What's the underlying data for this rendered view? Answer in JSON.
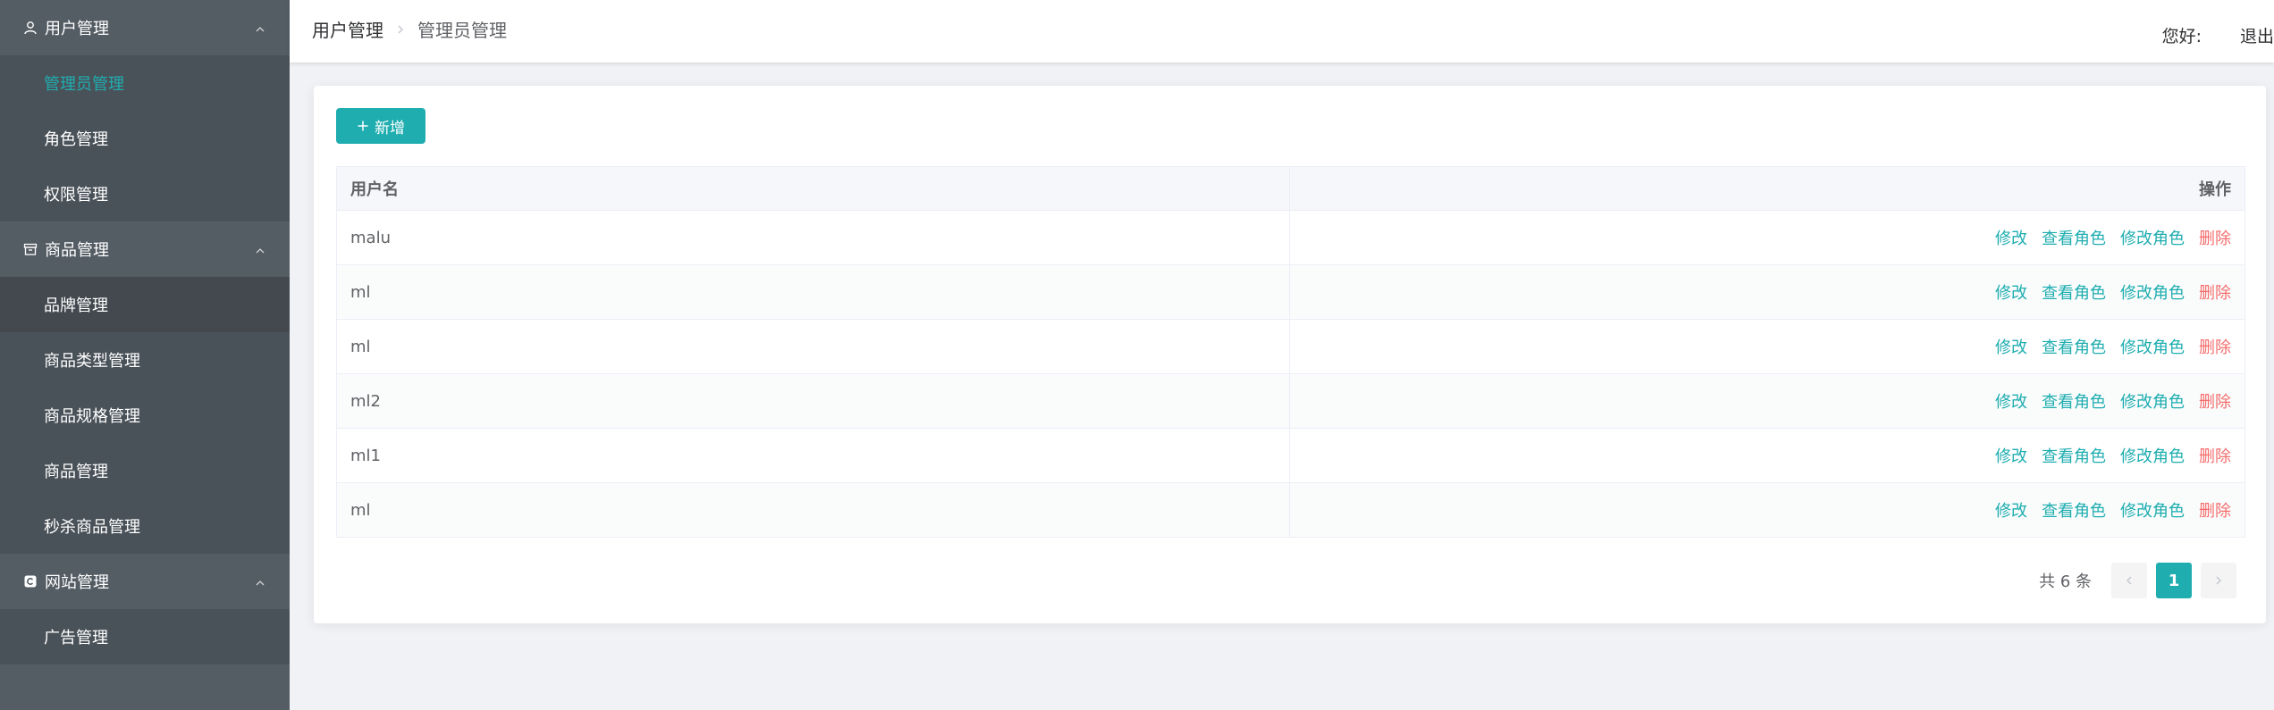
{
  "colors": {
    "accent": "#1fadb0",
    "danger": "#f56c6c",
    "sidebar_bg": "#545c64"
  },
  "sidebar": {
    "groups": [
      {
        "title": "用户管理",
        "icon": "user-icon",
        "items": [
          {
            "label": "管理员管理",
            "active": true
          },
          {
            "label": "角色管理"
          },
          {
            "label": "权限管理"
          }
        ]
      },
      {
        "title": "商品管理",
        "icon": "box-icon",
        "items": [
          {
            "label": "品牌管理"
          },
          {
            "label": "商品类型管理"
          },
          {
            "label": "商品规格管理"
          },
          {
            "label": "商品管理"
          },
          {
            "label": "秒杀商品管理"
          }
        ]
      },
      {
        "title": "网站管理",
        "icon": "site-icon",
        "items": [
          {
            "label": "广告管理"
          }
        ]
      }
    ]
  },
  "header": {
    "breadcrumb": [
      "用户管理",
      "管理员管理"
    ],
    "greeting": "您好:",
    "logout": "退出"
  },
  "toolbar": {
    "add_label": "新增"
  },
  "table": {
    "columns": [
      "用户名",
      "操作"
    ],
    "actions": {
      "edit": "修改",
      "view_roles": "查看角色",
      "edit_roles": "修改角色",
      "delete": "删除"
    },
    "rows": [
      {
        "username": "malu"
      },
      {
        "username": "ml"
      },
      {
        "username": "ml"
      },
      {
        "username": "ml2"
      },
      {
        "username": "ml1"
      },
      {
        "username": "ml"
      }
    ]
  },
  "pagination": {
    "total_text": "共 6 条",
    "current_page": "1"
  }
}
